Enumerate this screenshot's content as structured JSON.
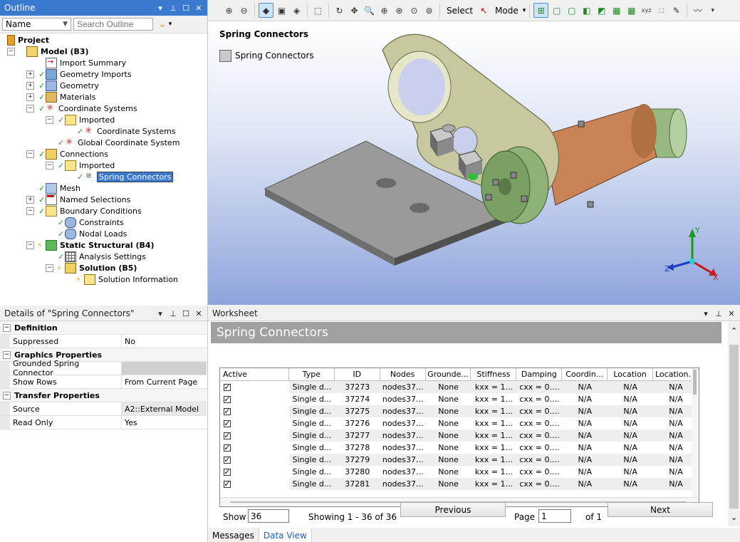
{
  "outline": {
    "title": "Outline",
    "filter_select": "Name",
    "search_placeholder": "Search Outline",
    "tree": [
      {
        "label": "Project",
        "bold": true
      },
      {
        "label": "Model (B3)",
        "bold": true
      },
      {
        "label": "Import Summary"
      },
      {
        "label": "Geometry Imports"
      },
      {
        "label": "Geometry"
      },
      {
        "label": "Materials"
      },
      {
        "label": "Coordinate Systems"
      },
      {
        "label": "Imported"
      },
      {
        "label": "Coordinate Systems"
      },
      {
        "label": "Global Coordinate System"
      },
      {
        "label": "Connections"
      },
      {
        "label": "Imported"
      },
      {
        "label": "Spring Connectors",
        "selected": true
      },
      {
        "label": "Mesh"
      },
      {
        "label": "Named Selections"
      },
      {
        "label": "Boundary Conditions"
      },
      {
        "label": "Constraints"
      },
      {
        "label": "Nodal Loads"
      },
      {
        "label": "Static Structural (B4)",
        "bold": true
      },
      {
        "label": "Analysis Settings"
      },
      {
        "label": "Solution (B5)",
        "bold": true
      },
      {
        "label": "Solution Information"
      }
    ]
  },
  "details": {
    "title": "Details of \"Spring Connectors\"",
    "groups": [
      {
        "name": "Definition",
        "rows": [
          {
            "label": "Suppressed",
            "value": "No"
          }
        ]
      },
      {
        "name": "Graphics Properties",
        "rows": [
          {
            "label": "Grounded Spring Connector",
            "value": ""
          },
          {
            "label": "Show Rows",
            "value": "From Current Page"
          }
        ]
      },
      {
        "name": "Transfer Properties",
        "rows": [
          {
            "label": "Source",
            "value": "A2::External Model"
          },
          {
            "label": "Read Only",
            "value": "Yes"
          }
        ]
      }
    ]
  },
  "toolbar": {
    "select_label": "Select",
    "mode_label": "Mode"
  },
  "viewport": {
    "title": "Spring Connectors",
    "legend_label": "Spring Connectors",
    "axis_x": "X",
    "axis_y": "Y",
    "axis_z": "Z"
  },
  "worksheet": {
    "panel_title": "Worksheet",
    "header": "Spring Connectors",
    "columns": [
      "Active",
      "Type",
      "ID",
      "Nodes",
      "Grounde...",
      "Stiffness",
      "Damping",
      "Coordin...",
      "Location",
      "Location..."
    ],
    "rows": [
      [
        "Single d...",
        "37273",
        "nodes37...",
        "None",
        "kxx = 1...",
        "cxx = 0....",
        "N/A",
        "N/A",
        "N/A"
      ],
      [
        "Single d...",
        "37274",
        "nodes37...",
        "None",
        "kxx = 1...",
        "cxx = 0....",
        "N/A",
        "N/A",
        "N/A"
      ],
      [
        "Single d...",
        "37275",
        "nodes37...",
        "None",
        "kxx = 1...",
        "cxx = 0....",
        "N/A",
        "N/A",
        "N/A"
      ],
      [
        "Single d...",
        "37276",
        "nodes37...",
        "None",
        "kxx = 1...",
        "cxx = 0....",
        "N/A",
        "N/A",
        "N/A"
      ],
      [
        "Single d...",
        "37277",
        "nodes37...",
        "None",
        "kxx = 1...",
        "cxx = 0....",
        "N/A",
        "N/A",
        "N/A"
      ],
      [
        "Single d...",
        "37278",
        "nodes37...",
        "None",
        "kxx = 1...",
        "cxx = 0....",
        "N/A",
        "N/A",
        "N/A"
      ],
      [
        "Single d...",
        "37279",
        "nodes37...",
        "None",
        "kxx = 1...",
        "cxx = 0....",
        "N/A",
        "N/A",
        "N/A"
      ],
      [
        "Single d...",
        "37280",
        "nodes37...",
        "None",
        "kxx = 1...",
        "cxx = 0....",
        "N/A",
        "N/A",
        "N/A"
      ],
      [
        "Single d...",
        "37281",
        "nodes37...",
        "None",
        "kxx = 1...",
        "cxx = 0....",
        "N/A",
        "N/A",
        "N/A"
      ]
    ],
    "show_label": "Show",
    "show_value": "36",
    "showing_text": "Showing 1 - 36 of 36",
    "previous_label": "Previous",
    "page_label": "Page",
    "page_value": "1",
    "of_text": "of 1",
    "next_label": "Next"
  },
  "bottom_tabs": [
    "Messages",
    "Data View"
  ],
  "colors": {
    "accent": "#3a79d0",
    "check": "#2a9d2a",
    "worksheet_header": "#a0a0a0"
  }
}
